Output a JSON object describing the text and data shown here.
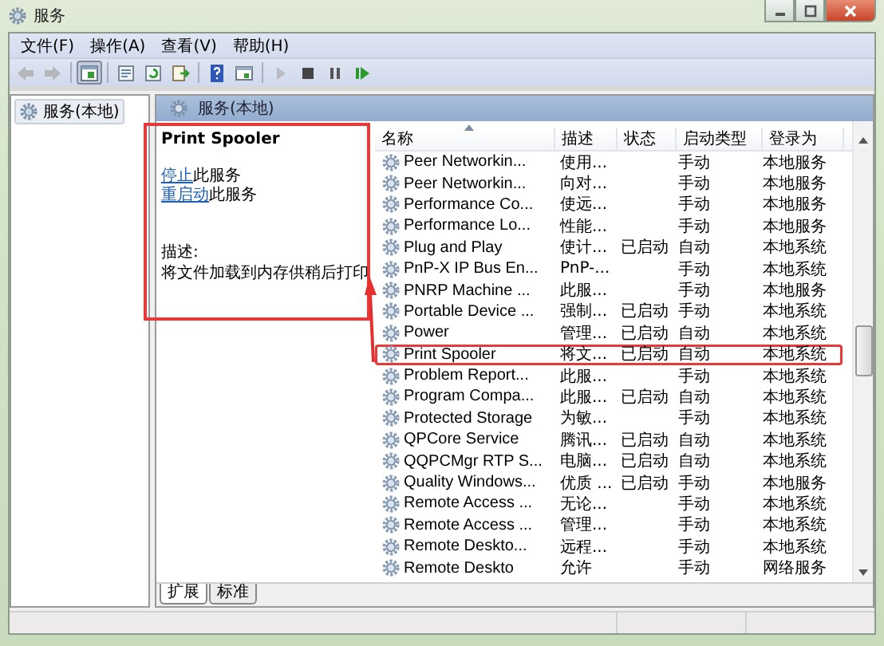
{
  "window": {
    "title": "服务"
  },
  "menu": [
    {
      "label": "文件(F)"
    },
    {
      "label": "操作(A)"
    },
    {
      "label": "查看(V)"
    },
    {
      "label": "帮助(H)"
    }
  ],
  "toolbar": [
    {
      "kind": "back",
      "disabled": true,
      "pressed": false
    },
    {
      "kind": "forward",
      "disabled": true,
      "pressed": false
    },
    {
      "kind": "sep"
    },
    {
      "kind": "tree",
      "disabled": false,
      "pressed": true
    },
    {
      "kind": "sep"
    },
    {
      "kind": "properties",
      "disabled": false,
      "pressed": false
    },
    {
      "kind": "refresh",
      "disabled": false,
      "pressed": false
    },
    {
      "kind": "export",
      "disabled": false,
      "pressed": false
    },
    {
      "kind": "sep"
    },
    {
      "kind": "help",
      "disabled": false,
      "pressed": false
    },
    {
      "kind": "view",
      "disabled": false,
      "pressed": false
    },
    {
      "kind": "sep"
    },
    {
      "kind": "play",
      "disabled": true,
      "pressed": false
    },
    {
      "kind": "stop",
      "disabled": false,
      "pressed": false
    },
    {
      "kind": "pause",
      "disabled": false,
      "pressed": false
    },
    {
      "kind": "restart",
      "disabled": false,
      "pressed": false
    }
  ],
  "tree": [
    {
      "label": "服务(本地)",
      "selected": true
    }
  ],
  "panel_header": "服务(本地)",
  "details": {
    "title": "Print Spooler",
    "marked": true,
    "links": [
      {
        "link": "停止",
        "text": "此服务"
      },
      {
        "link": "重启动",
        "text": "此服务"
      }
    ],
    "description_label": "描述:",
    "description": "将文件加载到内存供稍后打印"
  },
  "table": {
    "columns": [
      {
        "label": "名称",
        "sorted": true
      },
      {
        "label": "描述",
        "sorted": false
      },
      {
        "label": "状态",
        "sorted": false
      },
      {
        "label": "启动类型",
        "sorted": false
      },
      {
        "label": "登录为",
        "sorted": false
      }
    ],
    "rows": [
      {
        "cells": [
          "Peer Networkin...",
          "使用...",
          "",
          "手动",
          "本地服务"
        ],
        "marked": false
      },
      {
        "cells": [
          "Peer Networkin...",
          "向对...",
          "",
          "手动",
          "本地服务"
        ],
        "marked": false
      },
      {
        "cells": [
          "Performance Co...",
          "使远...",
          "",
          "手动",
          "本地服务"
        ],
        "marked": false
      },
      {
        "cells": [
          "Performance Lo...",
          "性能...",
          "",
          "手动",
          "本地服务"
        ],
        "marked": false
      },
      {
        "cells": [
          "Plug and Play",
          "使计...",
          "已启动",
          "自动",
          "本地系统"
        ],
        "marked": false
      },
      {
        "cells": [
          "PnP-X IP Bus En...",
          "PnP-...",
          "",
          "手动",
          "本地系统"
        ],
        "marked": false
      },
      {
        "cells": [
          "PNRP Machine ...",
          "此服...",
          "",
          "手动",
          "本地服务"
        ],
        "marked": false
      },
      {
        "cells": [
          "Portable Device ...",
          "强制...",
          "已启动",
          "手动",
          "本地系统"
        ],
        "marked": false
      },
      {
        "cells": [
          "Power",
          "管理...",
          "已启动",
          "自动",
          "本地系统"
        ],
        "marked": false
      },
      {
        "cells": [
          "Print Spooler",
          "将文...",
          "已启动",
          "自动",
          "本地系统"
        ],
        "marked": true
      },
      {
        "cells": [
          "Problem Report...",
          "此服...",
          "",
          "手动",
          "本地系统"
        ],
        "marked": false
      },
      {
        "cells": [
          "Program Compa...",
          "此服...",
          "已启动",
          "自动",
          "本地系统"
        ],
        "marked": false
      },
      {
        "cells": [
          "Protected Storage",
          "为敏...",
          "",
          "手动",
          "本地系统"
        ],
        "marked": false
      },
      {
        "cells": [
          "QPCore Service",
          "腾讯...",
          "已启动",
          "自动",
          "本地系统"
        ],
        "marked": false
      },
      {
        "cells": [
          "QQPCMgr RTP S...",
          "电脑...",
          "已启动",
          "自动",
          "本地系统"
        ],
        "marked": false
      },
      {
        "cells": [
          "Quality Windows...",
          "优质 ...",
          "已启动",
          "手动",
          "本地服务"
        ],
        "marked": false
      },
      {
        "cells": [
          "Remote Access ...",
          "无论...",
          "",
          "手动",
          "本地系统"
        ],
        "marked": false
      },
      {
        "cells": [
          "Remote Access ...",
          "管理...",
          "",
          "手动",
          "本地系统"
        ],
        "marked": false
      },
      {
        "cells": [
          "Remote Deskto...",
          "远程...",
          "",
          "手动",
          "本地系统"
        ],
        "marked": false
      },
      {
        "cells": [
          "Remote Deskto",
          "允许",
          "",
          "手动",
          "网络服务"
        ],
        "marked": false
      }
    ]
  },
  "tabs": [
    {
      "label": "扩展",
      "selected": true
    },
    {
      "label": "标准",
      "selected": false
    }
  ]
}
